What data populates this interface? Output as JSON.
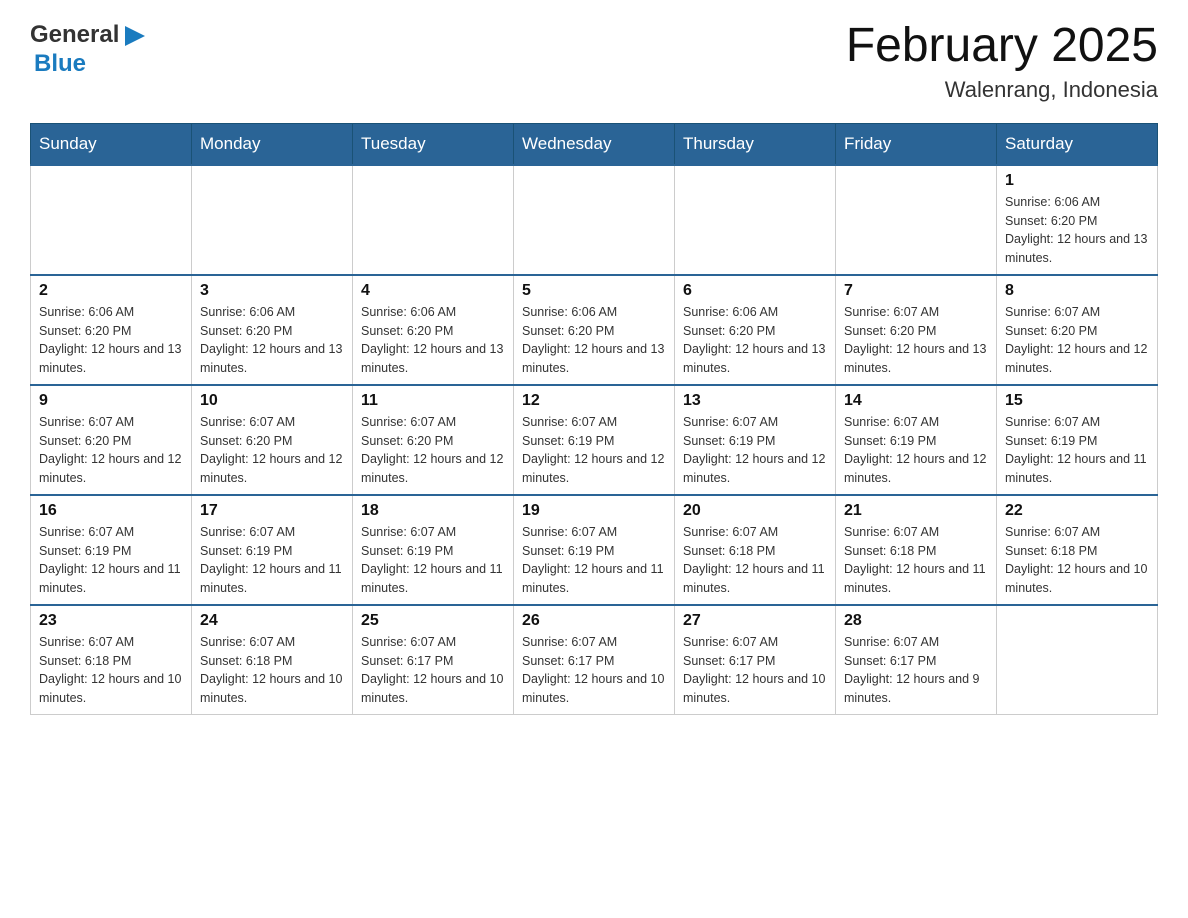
{
  "header": {
    "logo_general": "General",
    "logo_blue": "Blue",
    "title": "February 2025",
    "location": "Walenrang, Indonesia"
  },
  "days_of_week": [
    "Sunday",
    "Monday",
    "Tuesday",
    "Wednesday",
    "Thursday",
    "Friday",
    "Saturday"
  ],
  "weeks": [
    [
      {
        "day": "",
        "sunrise": "",
        "sunset": "",
        "daylight": ""
      },
      {
        "day": "",
        "sunrise": "",
        "sunset": "",
        "daylight": ""
      },
      {
        "day": "",
        "sunrise": "",
        "sunset": "",
        "daylight": ""
      },
      {
        "day": "",
        "sunrise": "",
        "sunset": "",
        "daylight": ""
      },
      {
        "day": "",
        "sunrise": "",
        "sunset": "",
        "daylight": ""
      },
      {
        "day": "",
        "sunrise": "",
        "sunset": "",
        "daylight": ""
      },
      {
        "day": "1",
        "sunrise": "Sunrise: 6:06 AM",
        "sunset": "Sunset: 6:20 PM",
        "daylight": "Daylight: 12 hours and 13 minutes."
      }
    ],
    [
      {
        "day": "2",
        "sunrise": "Sunrise: 6:06 AM",
        "sunset": "Sunset: 6:20 PM",
        "daylight": "Daylight: 12 hours and 13 minutes."
      },
      {
        "day": "3",
        "sunrise": "Sunrise: 6:06 AM",
        "sunset": "Sunset: 6:20 PM",
        "daylight": "Daylight: 12 hours and 13 minutes."
      },
      {
        "day": "4",
        "sunrise": "Sunrise: 6:06 AM",
        "sunset": "Sunset: 6:20 PM",
        "daylight": "Daylight: 12 hours and 13 minutes."
      },
      {
        "day": "5",
        "sunrise": "Sunrise: 6:06 AM",
        "sunset": "Sunset: 6:20 PM",
        "daylight": "Daylight: 12 hours and 13 minutes."
      },
      {
        "day": "6",
        "sunrise": "Sunrise: 6:06 AM",
        "sunset": "Sunset: 6:20 PM",
        "daylight": "Daylight: 12 hours and 13 minutes."
      },
      {
        "day": "7",
        "sunrise": "Sunrise: 6:07 AM",
        "sunset": "Sunset: 6:20 PM",
        "daylight": "Daylight: 12 hours and 13 minutes."
      },
      {
        "day": "8",
        "sunrise": "Sunrise: 6:07 AM",
        "sunset": "Sunset: 6:20 PM",
        "daylight": "Daylight: 12 hours and 12 minutes."
      }
    ],
    [
      {
        "day": "9",
        "sunrise": "Sunrise: 6:07 AM",
        "sunset": "Sunset: 6:20 PM",
        "daylight": "Daylight: 12 hours and 12 minutes."
      },
      {
        "day": "10",
        "sunrise": "Sunrise: 6:07 AM",
        "sunset": "Sunset: 6:20 PM",
        "daylight": "Daylight: 12 hours and 12 minutes."
      },
      {
        "day": "11",
        "sunrise": "Sunrise: 6:07 AM",
        "sunset": "Sunset: 6:20 PM",
        "daylight": "Daylight: 12 hours and 12 minutes."
      },
      {
        "day": "12",
        "sunrise": "Sunrise: 6:07 AM",
        "sunset": "Sunset: 6:19 PM",
        "daylight": "Daylight: 12 hours and 12 minutes."
      },
      {
        "day": "13",
        "sunrise": "Sunrise: 6:07 AM",
        "sunset": "Sunset: 6:19 PM",
        "daylight": "Daylight: 12 hours and 12 minutes."
      },
      {
        "day": "14",
        "sunrise": "Sunrise: 6:07 AM",
        "sunset": "Sunset: 6:19 PM",
        "daylight": "Daylight: 12 hours and 12 minutes."
      },
      {
        "day": "15",
        "sunrise": "Sunrise: 6:07 AM",
        "sunset": "Sunset: 6:19 PM",
        "daylight": "Daylight: 12 hours and 11 minutes."
      }
    ],
    [
      {
        "day": "16",
        "sunrise": "Sunrise: 6:07 AM",
        "sunset": "Sunset: 6:19 PM",
        "daylight": "Daylight: 12 hours and 11 minutes."
      },
      {
        "day": "17",
        "sunrise": "Sunrise: 6:07 AM",
        "sunset": "Sunset: 6:19 PM",
        "daylight": "Daylight: 12 hours and 11 minutes."
      },
      {
        "day": "18",
        "sunrise": "Sunrise: 6:07 AM",
        "sunset": "Sunset: 6:19 PM",
        "daylight": "Daylight: 12 hours and 11 minutes."
      },
      {
        "day": "19",
        "sunrise": "Sunrise: 6:07 AM",
        "sunset": "Sunset: 6:19 PM",
        "daylight": "Daylight: 12 hours and 11 minutes."
      },
      {
        "day": "20",
        "sunrise": "Sunrise: 6:07 AM",
        "sunset": "Sunset: 6:18 PM",
        "daylight": "Daylight: 12 hours and 11 minutes."
      },
      {
        "day": "21",
        "sunrise": "Sunrise: 6:07 AM",
        "sunset": "Sunset: 6:18 PM",
        "daylight": "Daylight: 12 hours and 11 minutes."
      },
      {
        "day": "22",
        "sunrise": "Sunrise: 6:07 AM",
        "sunset": "Sunset: 6:18 PM",
        "daylight": "Daylight: 12 hours and 10 minutes."
      }
    ],
    [
      {
        "day": "23",
        "sunrise": "Sunrise: 6:07 AM",
        "sunset": "Sunset: 6:18 PM",
        "daylight": "Daylight: 12 hours and 10 minutes."
      },
      {
        "day": "24",
        "sunrise": "Sunrise: 6:07 AM",
        "sunset": "Sunset: 6:18 PM",
        "daylight": "Daylight: 12 hours and 10 minutes."
      },
      {
        "day": "25",
        "sunrise": "Sunrise: 6:07 AM",
        "sunset": "Sunset: 6:17 PM",
        "daylight": "Daylight: 12 hours and 10 minutes."
      },
      {
        "day": "26",
        "sunrise": "Sunrise: 6:07 AM",
        "sunset": "Sunset: 6:17 PM",
        "daylight": "Daylight: 12 hours and 10 minutes."
      },
      {
        "day": "27",
        "sunrise": "Sunrise: 6:07 AM",
        "sunset": "Sunset: 6:17 PM",
        "daylight": "Daylight: 12 hours and 10 minutes."
      },
      {
        "day": "28",
        "sunrise": "Sunrise: 6:07 AM",
        "sunset": "Sunset: 6:17 PM",
        "daylight": "Daylight: 12 hours and 9 minutes."
      },
      {
        "day": "",
        "sunrise": "",
        "sunset": "",
        "daylight": ""
      }
    ]
  ]
}
